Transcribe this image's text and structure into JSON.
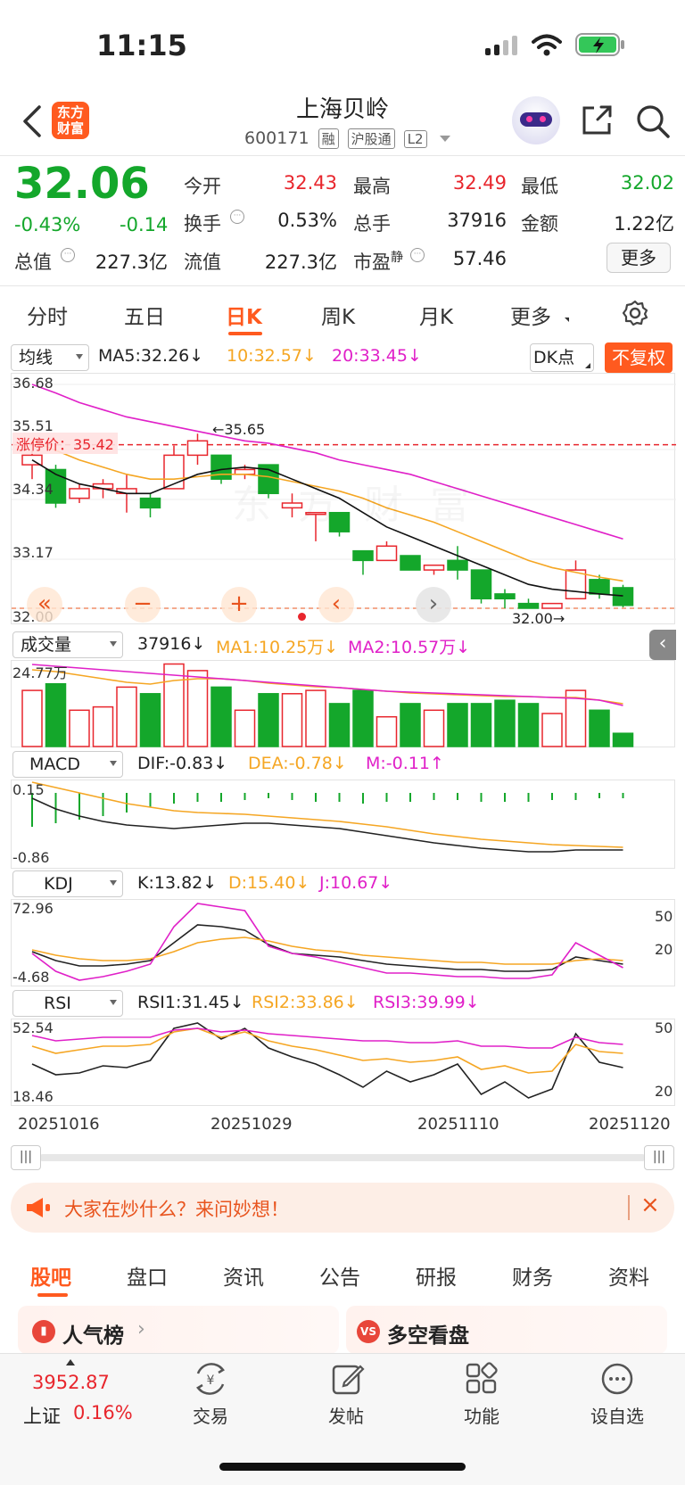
{
  "status": {
    "time": "11:15"
  },
  "header": {
    "logo": "东方财富",
    "title": "上海贝岭",
    "code": "600171",
    "chips": [
      "融",
      "沪股通",
      "L2"
    ]
  },
  "quote": {
    "price": "32.06",
    "change_pct": "-0.43%",
    "change": "-0.14",
    "open_label": "今开",
    "open": "32.43",
    "high_label": "最高",
    "high": "32.49",
    "low_label": "最低",
    "low": "32.02",
    "turnover_label": "换手",
    "turnover": "0.53%",
    "volume_label": "总手",
    "volume": "37916",
    "amount_label": "金额",
    "amount": "1.22亿",
    "mktcap_label": "总值",
    "mktcap": "227.3亿",
    "float_label": "流值",
    "float": "227.3亿",
    "pe_label": "市盈",
    "pe_sup": "静",
    "pe": "57.46",
    "more_button": "更多"
  },
  "tabs": [
    "分时",
    "五日",
    "日K",
    "周K",
    "月K",
    "更多"
  ],
  "active_tab": "日K",
  "kline": {
    "ma_select": "均线",
    "ma5": "MA5:32.26",
    "ma10": "10:32.57",
    "ma20": "20:33.45",
    "dk_button": "DK点",
    "adjust_button": "不复权",
    "y_labels": [
      "36.68",
      "35.51",
      "34.34",
      "33.17",
      "32.00"
    ],
    "limit_up_label": "涨停价：35.42",
    "high_marker": "35.65",
    "low_marker": "32.00",
    "arrow_down": "↓",
    "controls": [
      "«",
      "−",
      "+",
      "‹",
      "›"
    ]
  },
  "volume": {
    "select": "成交量",
    "value": "37916",
    "ma1": "MA1:10.25万",
    "ma2": "MA2:10.57万",
    "y_max": "24.77万"
  },
  "macd": {
    "select": "MACD",
    "dif": "DIF:-0.83",
    "dea": "DEA:-0.78",
    "m": "M:-0.11",
    "up_arrow": "↑",
    "y_max": "0.15",
    "y_min": "-0.86"
  },
  "kdj": {
    "select": "KDJ",
    "k": "K:13.82",
    "d": "D:15.40",
    "j": "J:10.67",
    "y_max": "72.96",
    "y_min": "-4.68",
    "r1": "50",
    "r2": "20"
  },
  "rsi": {
    "select": "RSI",
    "rsi1": "RSI1:31.45",
    "rsi2": "RSI2:33.86",
    "rsi3": "RSI3:39.99",
    "y_max": "52.54",
    "y_min": "18.46",
    "r1": "50",
    "r2": "20"
  },
  "dates": [
    "20251016",
    "20251029",
    "20251110",
    "20251120"
  ],
  "banner": {
    "text": "大家在炒什么？来问妙想！"
  },
  "bottom_tabs": [
    "股吧",
    "盘口",
    "资讯",
    "公告",
    "研报",
    "财务",
    "资料"
  ],
  "cards": {
    "left": "人气榜",
    "right": "多空看盘"
  },
  "nav": {
    "index_value": "3952.87",
    "index_name": "上证",
    "index_change": "0.16%",
    "items": [
      "交易",
      "发帖",
      "功能",
      "设自选"
    ]
  },
  "colors": {
    "up": "#e8262d",
    "down": "#14a72b",
    "accent": "#ff6a1a",
    "ma10": "#f5a623",
    "ma20": "#e020c8"
  }
}
